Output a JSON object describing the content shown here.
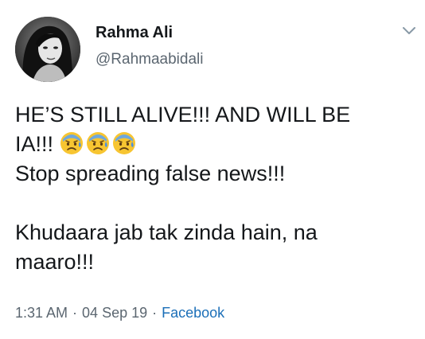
{
  "author": {
    "display_name": "Rahma Ali",
    "handle": "@Rahmaabidali"
  },
  "tweet": {
    "lines": [
      "HE’S STILL ALIVE!!! AND WILL BE",
      "IA!!!",
      "Stop spreading false news!!!",
      "",
      "Khudaara jab tak zinda hain, na",
      "maaro!!!"
    ],
    "emoji": [
      "anxious-face-with-sweat",
      "anxious-face-with-sweat",
      "anxious-face-with-sweat"
    ]
  },
  "meta": {
    "time": "1:31 AM",
    "separator": "·",
    "date": "04 Sep 19",
    "source": "Facebook"
  },
  "icons": {
    "menu": "chevron-down-icon"
  },
  "colors": {
    "text": "#14171a",
    "secondary": "#5b6670",
    "link": "#1b6fb8"
  }
}
